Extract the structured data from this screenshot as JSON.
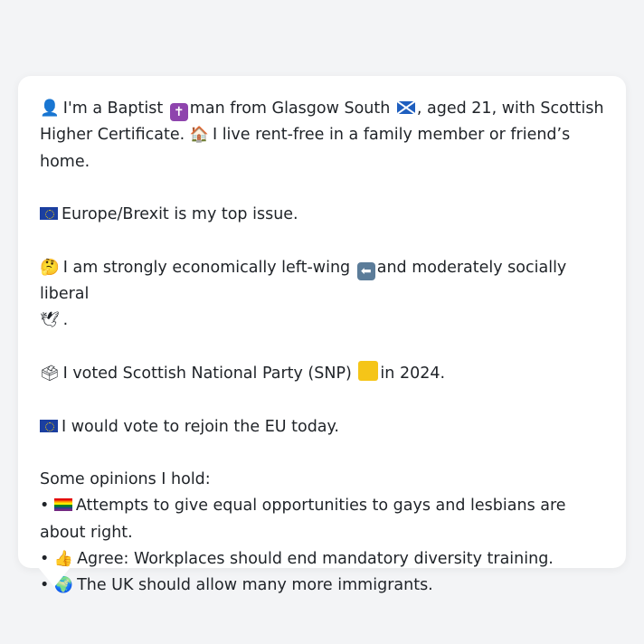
{
  "profile": {
    "line1_a": "I'm a Baptist",
    "line1_b": "man from Glasgow South",
    "line1_c": ", aged 21, with Scottish",
    "line2_a": "Higher Certificate.",
    "line2_b": "I live rent-free in a family member or friend’s home.",
    "top_issue": "Europe/Brexit is my top issue.",
    "stance_a": "I am strongly economically left-wing",
    "stance_b": "and moderately socially liberal",
    "stance_c": ".",
    "vote_a": "I voted Scottish National Party (SNP)",
    "vote_b": "in 2024.",
    "rejoin": "I would vote to rejoin the EU today.",
    "opinions_title": "Some opinions I hold:",
    "opinions": [
      "Attempts to give equal opportunities to gays and lesbians are about right.",
      "Agree: Workplaces should end mandatory diversity training.",
      "The UK should allow many more immigrants."
    ]
  },
  "icons": {
    "person": "bust-in-silhouette-icon",
    "religion": "latin-cross-icon",
    "scotland": "scotland-flag-icon",
    "home": "house-icon",
    "eu": "eu-flag-icon",
    "thinking": "thinking-face-icon",
    "left": "left-arrow-icon",
    "dove": "dove-icon",
    "ballot": "ballot-box-icon",
    "snp": "yellow-square-icon",
    "rainbow": "rainbow-flag-icon",
    "thumbs": "thumbs-up-icon",
    "globe": "globe-icon"
  },
  "colors": {
    "background": "#f3f4f6",
    "card": "#ffffff",
    "text": "#1f2328",
    "snp_yellow": "#f5c518"
  }
}
